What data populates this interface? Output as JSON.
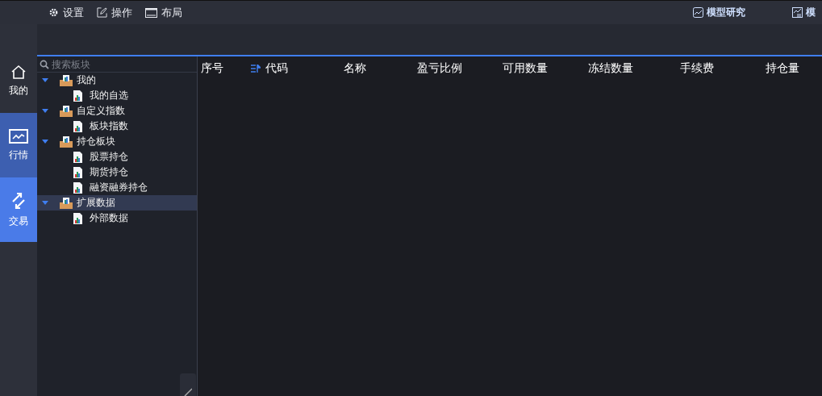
{
  "menu": [
    {
      "label": "设置"
    },
    {
      "label": "操作"
    },
    {
      "label": "布局"
    }
  ],
  "top_tabs": [
    {
      "label": "模型研究"
    },
    {
      "label": "模"
    }
  ],
  "nav": [
    {
      "label": "我的",
      "selected": false,
      "kind": "plain"
    },
    {
      "label": "行情",
      "selected": false,
      "kind": "highlight"
    },
    {
      "label": "交易",
      "selected": true,
      "kind": "highlight"
    }
  ],
  "search": {
    "placeholder": "搜索板块"
  },
  "tree": [
    {
      "label": "我的",
      "expanded": true,
      "selected": false,
      "children": [
        {
          "label": "我的自选",
          "selected": false
        }
      ]
    },
    {
      "label": "自定义指数",
      "expanded": true,
      "selected": false,
      "children": [
        {
          "label": "板块指数",
          "selected": false
        }
      ]
    },
    {
      "label": "持仓板块",
      "expanded": true,
      "selected": false,
      "children": [
        {
          "label": "股票持仓",
          "selected": false
        },
        {
          "label": "期货持仓",
          "selected": false
        },
        {
          "label": "融资融券持仓",
          "selected": false
        }
      ]
    },
    {
      "label": "扩展数据",
      "expanded": true,
      "selected": true,
      "children": [
        {
          "label": "外部数据",
          "selected": false
        }
      ]
    }
  ],
  "table": {
    "columns": [
      {
        "label": "序号",
        "sorted": false
      },
      {
        "label": "代码",
        "sorted": true
      },
      {
        "label": "名称",
        "sorted": false
      },
      {
        "label": "盈亏比例",
        "sorted": false
      },
      {
        "label": "可用数量",
        "sorted": false
      },
      {
        "label": "冻结数量",
        "sorted": false
      },
      {
        "label": "手续费",
        "sorted": false
      },
      {
        "label": "持仓量",
        "sorted": false
      }
    ]
  }
}
